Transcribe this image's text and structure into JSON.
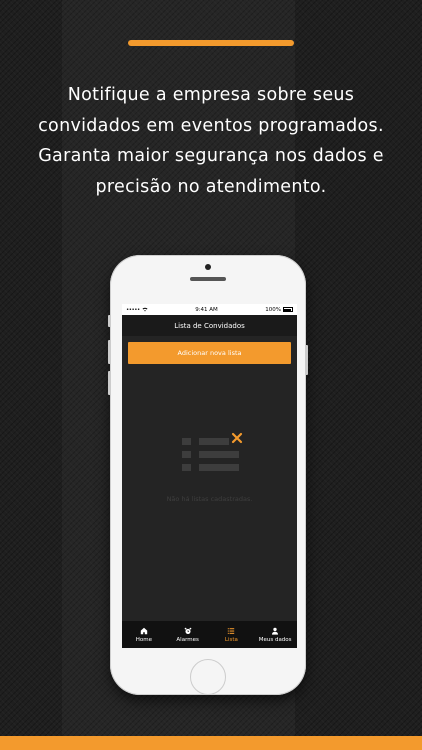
{
  "headline": [
    "Notifique a empresa sobre seus",
    "convidados em eventos programados.",
    "Garanta maior segurança nos dados e",
    "precisão no atendimento."
  ],
  "status_bar": {
    "carrier": "•••••",
    "time": "9:41 AM",
    "battery": "100%"
  },
  "screen_title": "Lista de Convidados",
  "add_list_button": "Adicionar nova lista",
  "empty_message": "Não há listas cadastradas.",
  "tabs": [
    {
      "label": "Home",
      "icon": "home-icon",
      "active": false
    },
    {
      "label": "Alarmes",
      "icon": "alarm-clock-icon",
      "active": false
    },
    {
      "label": "Lista",
      "icon": "list-icon",
      "active": true
    },
    {
      "label": "Meus dados",
      "icon": "user-icon",
      "active": false
    }
  ],
  "colors": {
    "accent": "#f39a2d",
    "background": "#1f1f1f",
    "screen_bg": "#242424"
  }
}
